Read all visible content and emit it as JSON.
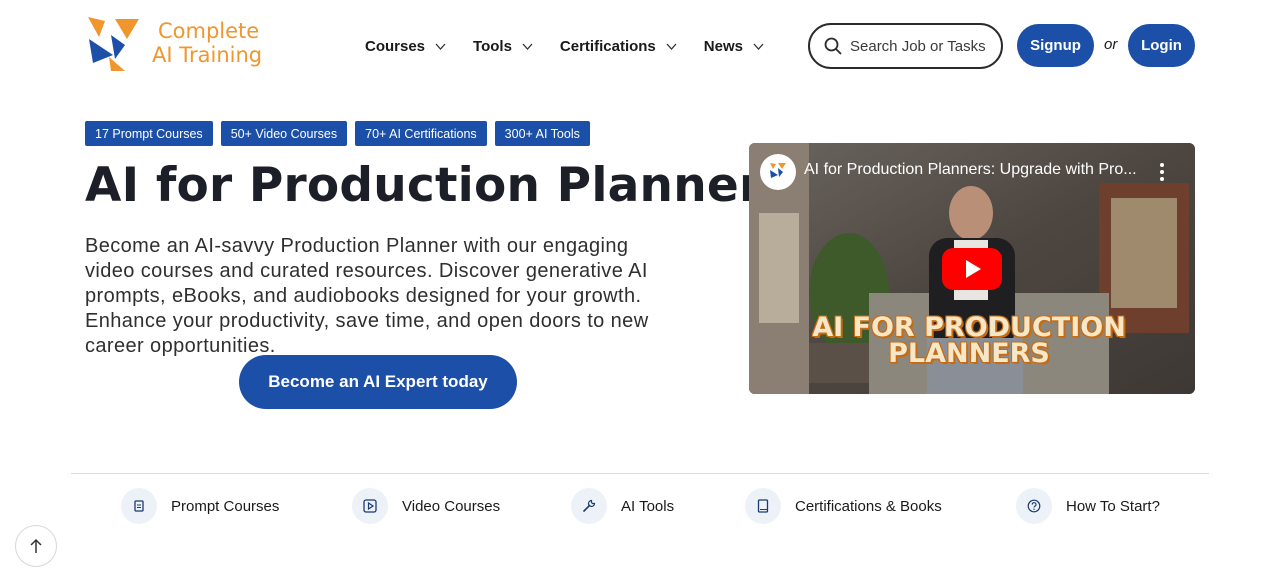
{
  "header": {
    "logo": {
      "line1": "Complete",
      "line2": "AI Training",
      "icon": "logo-icon"
    },
    "nav": [
      {
        "label": "Courses",
        "icon": "chevron-down-icon"
      },
      {
        "label": "Tools",
        "icon": "chevron-down-icon"
      },
      {
        "label": "Certifications",
        "icon": "chevron-down-icon"
      },
      {
        "label": "News",
        "icon": "chevron-down-icon"
      }
    ],
    "search": {
      "placeholder": "Search Job or Tasks",
      "icon": "search-icon"
    },
    "signup_label": "Signup",
    "or_text": "or",
    "login_label": "Login"
  },
  "hero": {
    "badges": [
      "17 Prompt Courses",
      "50+ Video Courses",
      "70+ AI Certifications",
      "300+ AI Tools"
    ],
    "title": "AI for Production Planners",
    "description": "Become an AI-savvy Production Planner with our engaging video courses and curated resources. Discover generative AI prompts, eBooks, and audiobooks designed for your growth. Enhance your productivity, save time, and open doors to new career opportunities.",
    "cta_label": "Become an AI Expert today"
  },
  "video": {
    "title": "AI for Production Planners: Upgrade with Pro...",
    "caption_line1": "AI FOR PRODUCTION",
    "caption_line2": "PLANNERS",
    "icons": [
      "channel-avatar-icon",
      "more-vert-icon",
      "play-icon"
    ]
  },
  "bottom_nav": [
    {
      "label": "Prompt Courses",
      "icon": "document-icon"
    },
    {
      "label": "Video Courses",
      "icon": "video-play-icon"
    },
    {
      "label": "AI Tools",
      "icon": "wrench-icon"
    },
    {
      "label": "Certifications & Books",
      "icon": "book-icon"
    },
    {
      "label": "How To Start?",
      "icon": "question-icon"
    }
  ],
  "colors": {
    "brand_blue": "#1b4fa8",
    "logo_orange": "#f0962d",
    "logo_blue": "#1b4fa8",
    "icon_bg": "#edf1f8"
  }
}
